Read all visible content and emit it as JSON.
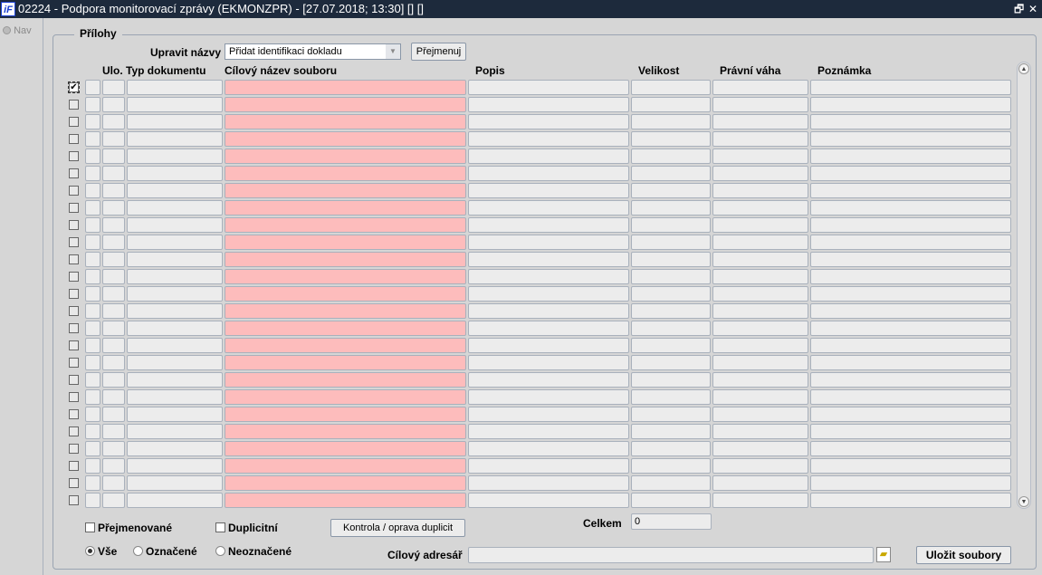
{
  "window": {
    "title": "02224 - Podpora monitorovací zprávy (EKMONZPR) - [27.07.2018; 13:30] [] []",
    "logo": "iF",
    "restore_icon": "🗗",
    "close_icon": "✕"
  },
  "nav": {
    "label": "Nav"
  },
  "section": {
    "title": "Přílohy"
  },
  "rename": {
    "label": "Upravit názvy",
    "selected": "Přidat identifikaci dokladu",
    "button": "Přejmenuj"
  },
  "columns": [
    "Ulo.",
    "Typ dokumentu",
    "Cílový název souboru",
    "Popis",
    "Velikost",
    "Právní váha",
    "Poznámka"
  ],
  "rows": [
    {
      "checked": true
    },
    {
      "checked": false
    },
    {
      "checked": false
    },
    {
      "checked": false
    },
    {
      "checked": false
    },
    {
      "checked": false
    },
    {
      "checked": false
    },
    {
      "checked": false
    },
    {
      "checked": false
    },
    {
      "checked": false
    },
    {
      "checked": false
    },
    {
      "checked": false
    },
    {
      "checked": false
    },
    {
      "checked": false
    },
    {
      "checked": false
    },
    {
      "checked": false
    },
    {
      "checked": false
    },
    {
      "checked": false
    },
    {
      "checked": false
    },
    {
      "checked": false
    },
    {
      "checked": false
    },
    {
      "checked": false
    },
    {
      "checked": false
    },
    {
      "checked": false
    },
    {
      "checked": false
    }
  ],
  "filters": {
    "renamed": "Přejmenované",
    "duplicate": "Duplicitní",
    "check_button": "Kontrola / oprava duplicit",
    "all": "Vše",
    "marked": "Označené",
    "unmarked": "Neoznačené"
  },
  "total": {
    "label": "Celkem",
    "value": "0"
  },
  "target": {
    "label": "Cílový adresář",
    "value": ""
  },
  "save_button": "Uložit soubory"
}
